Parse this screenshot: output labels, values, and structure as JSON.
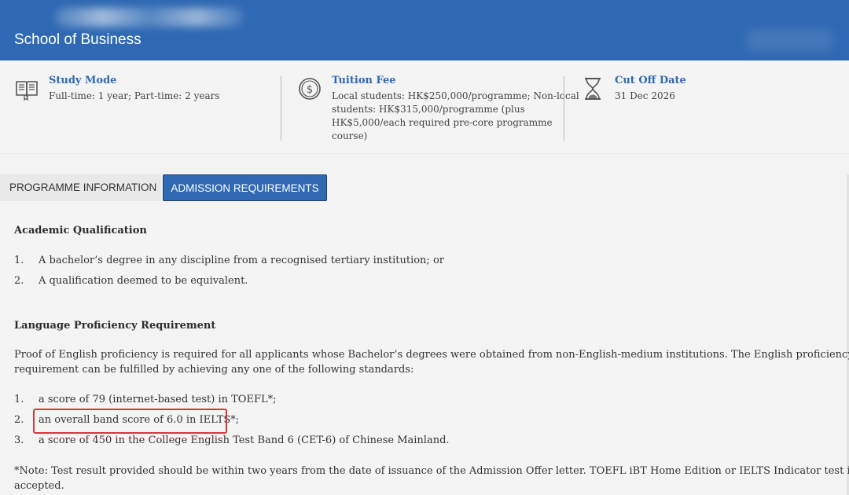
{
  "header": {
    "school_name": "School of Business"
  },
  "info": {
    "study_mode": {
      "icon": "book-icon",
      "title": "Study Mode",
      "desc": "Full-time: 1 year; Part-time: 2 years"
    },
    "tuition_fee": {
      "icon": "dollar-coin-icon",
      "title": "Tuition Fee",
      "desc_lines": [
        "Local students: HK$250,000/programme; Non-local",
        "students: HK$315,000/programme (plus",
        "HK$5,000/each required pre-core programme",
        "course)"
      ]
    },
    "cut_off": {
      "icon": "hourglass-icon",
      "title": "Cut Off Date",
      "desc": "31 Dec 2026"
    }
  },
  "tabs": {
    "programme_info": "PROGRAMME INFORMATION",
    "admission": "ADMISSION REQUIREMENTS"
  },
  "academic": {
    "title": "Academic Qualification",
    "items": [
      {
        "num": "1.",
        "text": "A bachelor’s degree in any discipline from a recognised tertiary institution; or"
      },
      {
        "num": "2.",
        "text": "A qualification deemed to be equivalent."
      }
    ]
  },
  "language": {
    "title": "Language Proficiency Requirement",
    "intro_lines": [
      "Proof of English proficiency is required for all applicants whose Bachelor’s degrees were obtained from non-English-medium institutions. The English proficiency",
      "requirement can be fulfilled by achieving any one of the following standards:"
    ],
    "items": [
      {
        "num": "1.",
        "text": "a score of 79 (internet-based test) in TOEFL*;"
      },
      {
        "num": "2.",
        "text": "an overall band score of 6.0 in IELTS*;"
      },
      {
        "num": "3.",
        "text": "a score of 450 in the College English Test Band 6 (CET-6) of Chinese Mainland."
      }
    ],
    "note_lines": [
      "*Note: Test result provided should be within two years from the date of issuance of the Admission Offer letter. TOEFL iBT Home Edition or IELTS Indicator test is not",
      "accepted."
    ]
  },
  "colors": {
    "header_bg": "#2f69b3",
    "title_blue": "#2f69b3",
    "highlight_red": "#d9363e"
  }
}
